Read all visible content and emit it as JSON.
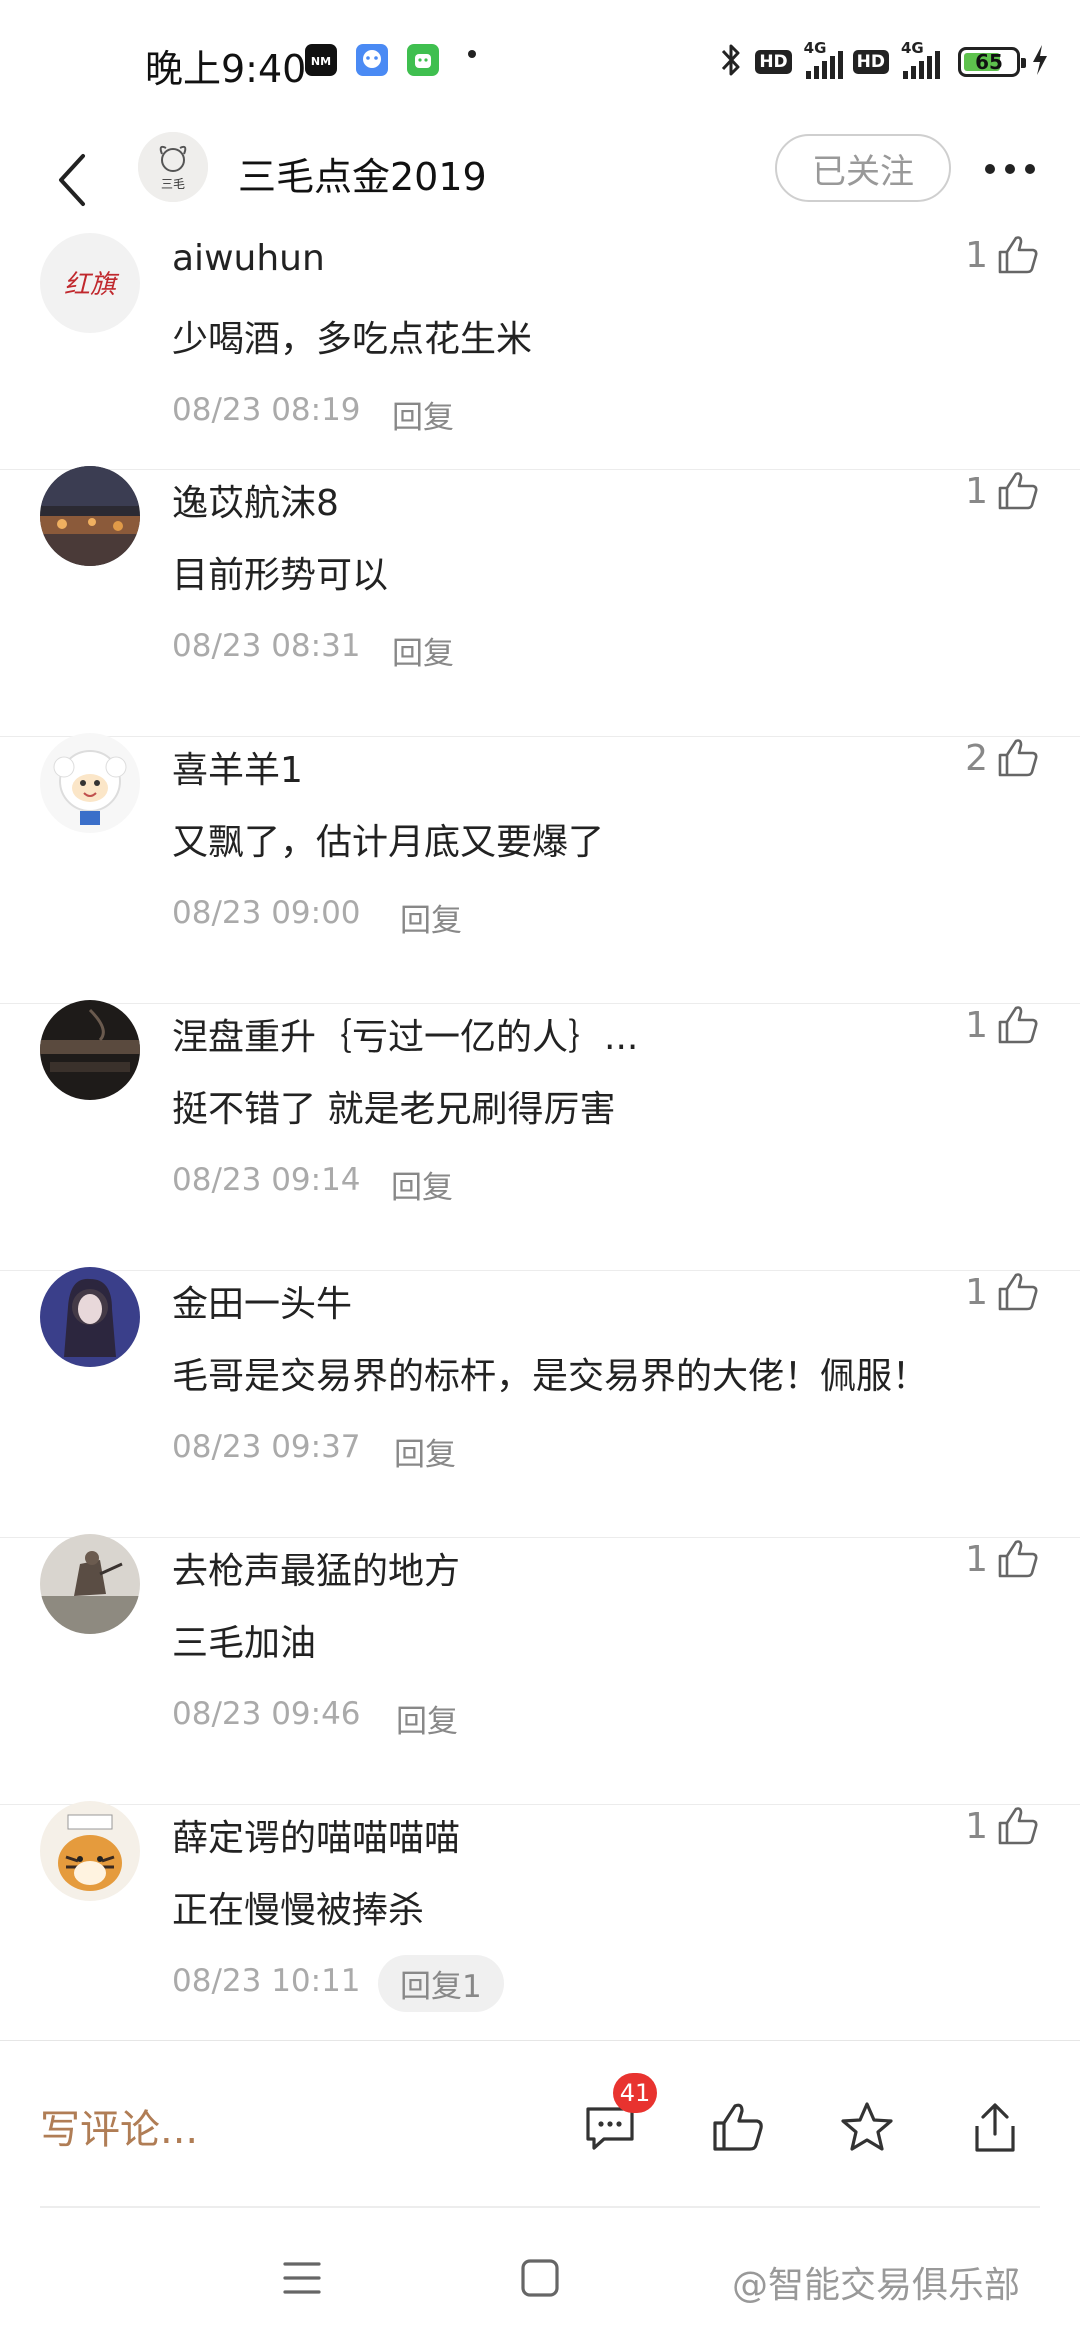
{
  "status_bar": {
    "time": "晚上9:40",
    "hd1": "HD",
    "net1": "4G",
    "hd2": "HD",
    "net2": "4G",
    "battery": "65"
  },
  "header": {
    "author_name": "三毛点金2019",
    "avatar_text": "三毛",
    "follow_label": "已关注"
  },
  "comments": [
    {
      "name": "aiwuhun",
      "text": "少喝酒，多吃点花生米",
      "time": "08/23 08:19",
      "reply": "回复",
      "likes": "1",
      "avatar_text": "红旗"
    },
    {
      "name": "逸苡航沫8",
      "text": "目前形势可以",
      "time": "08/23 08:31",
      "reply": "回复",
      "likes": "1"
    },
    {
      "name": "喜羊羊1",
      "text": "又飘了，估计月底又要爆了",
      "time": "08/23 09:00",
      "reply": "回复",
      "likes": "2"
    },
    {
      "name": "涅盘重升｛亏过一亿的人｝...",
      "text": "挺不错了 就是老兄刷得厉害",
      "time": "08/23 09:14",
      "reply": "回复",
      "likes": "1"
    },
    {
      "name": "金田一头牛",
      "text": "毛哥是交易界的标杆，是交易界的大佬！佩服！",
      "time": "08/23 09:37",
      "reply": "回复",
      "likes": "1"
    },
    {
      "name": "去枪声最猛的地方",
      "text": "三毛加油",
      "time": "08/23 09:46",
      "reply": "回复",
      "likes": "1"
    },
    {
      "name": "薛定谔的喵喵喵喵",
      "text": "正在慢慢被捧杀",
      "time": "08/23 10:11",
      "reply": "回复1",
      "likes": "1"
    }
  ],
  "action_bar": {
    "write_placeholder": "写评论...",
    "comment_count": "41"
  },
  "nav": {
    "watermark": "@智能交易俱乐部"
  },
  "colors": {
    "accent": "#b07d55",
    "badge": "#e8332f",
    "battery": "#5ec24d"
  }
}
